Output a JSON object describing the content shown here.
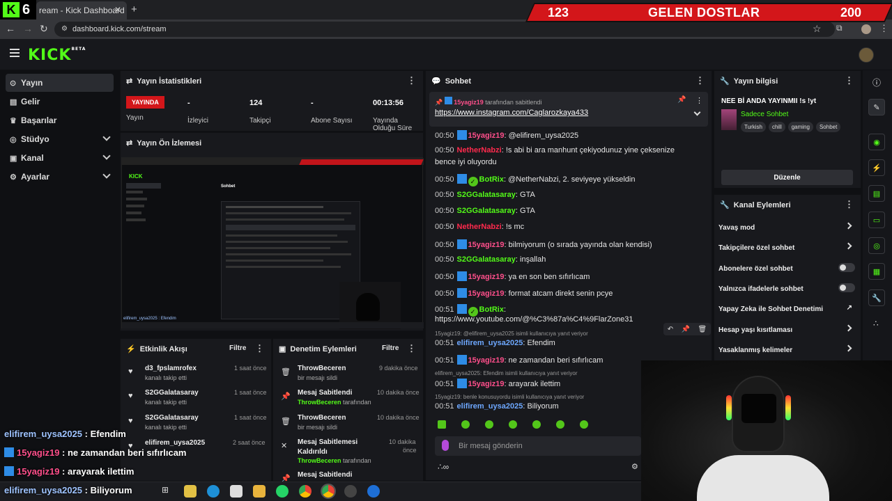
{
  "browser": {
    "tab_title": "ream - Kick Dashboard",
    "tab_close": "✕",
    "new_tab": "+",
    "url": "dashboard.kick.com/stream",
    "logo_number": "6"
  },
  "banner": {
    "left_count": "123",
    "title": "GELEN DOSTLAR",
    "right_count": "200"
  },
  "app": {
    "logo": "KICK",
    "logo_sup": "BETA"
  },
  "sidebar": {
    "items": [
      {
        "label": "Yayın",
        "icon": "⊙"
      },
      {
        "label": "Gelir",
        "icon": "▤"
      },
      {
        "label": "Başarılar",
        "icon": "♛"
      },
      {
        "label": "Stüdyo",
        "icon": "◎"
      },
      {
        "label": "Kanal",
        "icon": "▣"
      },
      {
        "label": "Ayarlar",
        "icon": "⚙"
      }
    ]
  },
  "stats": {
    "title": "Yayın İstatistikleri",
    "live_badge": "YAYINDA",
    "live_label": "Yayın",
    "viewers_value": "-",
    "viewers_label": "İzleyici",
    "followers_value": "124",
    "followers_label": "Takipçi",
    "subs_value": "-",
    "subs_label": "Abone Sayısı",
    "duration_value": "00:13:56",
    "duration_label_1": "Yayında",
    "duration_label_2": "Olduğu Süre"
  },
  "preview": {
    "title": "Yayın Ön İzlemesi",
    "mini_chat_title": "Sohbet",
    "mini_line": "elifirem_uysa2025 : Efendim"
  },
  "activity": {
    "title": "Etkinlik Akışı",
    "filter": "Filtre",
    "items": [
      {
        "name": "d3_fpslamrofex",
        "desc": "kanalı takip etti",
        "time": "1 saat önce"
      },
      {
        "name": "S2GGalatasaray",
        "desc": "kanalı takip etti",
        "time": "1 saat önce"
      },
      {
        "name": "S2GGalatasaray",
        "desc": "kanalı takip etti",
        "time": "1 saat önce"
      },
      {
        "name": "elifirem_uysa2025",
        "desc": "",
        "time": "2 saat önce"
      }
    ]
  },
  "moderation": {
    "title": "Denetim Eylemleri",
    "filter": "Filtre",
    "items": [
      {
        "name": "ThrowBeceren",
        "desc": "bir mesajı sildi",
        "time": "9 dakika önce",
        "icon": "🗑"
      },
      {
        "name": "Mesaj Sabitlendi",
        "desc_user": "ThrowBeceren",
        "desc": "tarafından",
        "time": "10 dakika önce",
        "icon": "📌"
      },
      {
        "name": "ThrowBeceren",
        "desc": "bir mesajı sildi",
        "time": "10 dakika önce",
        "icon": "🗑"
      },
      {
        "name": "Mesaj Sabitlemesi",
        "name2": "Kaldırıldı",
        "desc_user": "ThrowBeceren",
        "desc": "tarafından",
        "time": "10 dakika",
        "time2": "önce",
        "icon": "✕"
      },
      {
        "name": "Mesaj Sabitlendi",
        "desc": "",
        "time": "",
        "icon": "📌"
      }
    ]
  },
  "chat": {
    "title": "Sohbet",
    "pinned_by_user": "15yagiz19",
    "pinned_by_text": "tarafından sabitlendi",
    "pinned_link": "https://www.instagram.com/Caglarozkaya433",
    "messages": [
      {
        "ts": "00:50",
        "badge": "dev",
        "user": "15yagiz19",
        "color": "#ff4f8b",
        "text": ": @elifirem_uysa2025"
      },
      {
        "ts": "00:50",
        "badge": "",
        "user": "NetherNabzi",
        "color": "#ff2a4d",
        "text": ": !s abi bi ara manhunt çekiyodunuz yine çeksenize"
      },
      {
        "ts": "",
        "badge": "",
        "user": "",
        "color": "#fff",
        "text": "bence iyi oluyordu"
      },
      {
        "ts": "00:50",
        "badge": "bot",
        "user": "BotRix",
        "color": "#53fc18",
        "text": ": @NetherNabzi, 2. seviyeye yükseldin"
      },
      {
        "ts": "00:50",
        "badge": "",
        "user": "S2GGalatasaray",
        "color": "#53fc18",
        "text": ": GTA"
      },
      {
        "ts": "00:50",
        "badge": "",
        "user": "S2GGalatasaray",
        "color": "#53fc18",
        "text": ": GTA"
      },
      {
        "ts": "00:50",
        "badge": "",
        "user": "NetherNabzi",
        "color": "#ff2a4d",
        "text": ": !s mc"
      },
      {
        "ts": "00:50",
        "badge": "dev",
        "user": "15yagiz19",
        "color": "#ff4f8b",
        "text": ": bilmiyorum (o sırada yayında olan kendisi)"
      },
      {
        "ts": "00:50",
        "badge": "",
        "user": "S2GGalatasaray",
        "color": "#53fc18",
        "text": ": inşallah"
      },
      {
        "ts": "00:50",
        "badge": "dev",
        "user": "15yagiz19",
        "color": "#ff4f8b",
        "text": ": ya en son ben sıfırlıcam"
      },
      {
        "ts": "00:50",
        "badge": "dev",
        "user": "15yagiz19",
        "color": "#ff4f8b",
        "text": ": format atcam direkt senin pcye"
      },
      {
        "ts": "00:51",
        "badge": "bot",
        "user": "BotRix",
        "color": "#53fc18",
        "text": ":"
      },
      {
        "ts": "",
        "badge": "",
        "user": "",
        "color": "#fff",
        "text": "https://www.youtube.com/@%C3%87a%C4%9FlarZone31"
      },
      {
        "ts": "00:51",
        "badge": "",
        "user": "elifirem_uysa2025",
        "color": "#6ea8ff",
        "text": ": Efendim"
      },
      {
        "ts": "00:51",
        "badge": "dev",
        "user": "15yagiz19",
        "color": "#ff4f8b",
        "text": ": ne zamandan beri sıfırlıcam"
      },
      {
        "ts": "00:51",
        "badge": "dev",
        "user": "15yagiz19",
        "color": "#ff4f8b",
        "text": ": arayarak ilettim"
      },
      {
        "ts": "00:51",
        "badge": "",
        "user": "elifirem_uysa2025",
        "color": "#6ea8ff",
        "text": ": Biliyorum"
      }
    ],
    "reply_1": "15yagiz19: @elifirem_uysa2025 isimli kullanıcıya yanıt veriyor",
    "reply_2": "elifirem_uysa2025: Efendim isimli kullanıcıya yanıt veriyor",
    "reply_3": "15yagiz19: benle konusuyordu isimli kullanıcıya yanıt veriyor",
    "input_placeholder": "Bir mesaj gönderin"
  },
  "stream_info": {
    "title": "Yayın bilgisi",
    "stream_title": "NEE Bİ ANDA YAYINMII !s !yt",
    "category": "Sadece Sohbet",
    "tags": [
      "Turkish",
      "chill",
      "gaming",
      "Sohbet"
    ],
    "edit_button": "Düzenle"
  },
  "channel_actions": {
    "title": "Kanal Eylemleri",
    "rows": [
      {
        "label": "Yavaş mod",
        "kind": "arrow"
      },
      {
        "label": "Takipçilere özel sohbet",
        "kind": "arrow"
      },
      {
        "label": "Abonelere özel sohbet",
        "kind": "toggle"
      },
      {
        "label": "Yalnızca ifadelerle sohbet",
        "kind": "toggle"
      },
      {
        "label": "Yapay Zeka ile Sohbet Denetimi",
        "kind": "link"
      },
      {
        "label": "Hesap yaşı kısıtlaması",
        "kind": "arrow"
      },
      {
        "label": "Yasaklanmış kelimeler",
        "kind": "arrow"
      }
    ]
  },
  "overlay": {
    "lines": [
      {
        "user": "elifirem_uysa2025",
        "text": " : Efendim",
        "color": "#9ec3ff"
      },
      {
        "user": "15yagiz19",
        "text": " : ne zamandan beri sıfırlıcam",
        "color": "#ff4f8b"
      },
      {
        "user": "15yagiz19",
        "text": " : arayarak ilettim",
        "color": "#ff4f8b"
      },
      {
        "user": "elifirem_uysa2025",
        "text": " : Biliyorum",
        "color": "#9ec3ff"
      }
    ]
  },
  "colors": {
    "kick_green": "#53fc18",
    "live_red": "#d3161a",
    "panel": "#18191d"
  }
}
